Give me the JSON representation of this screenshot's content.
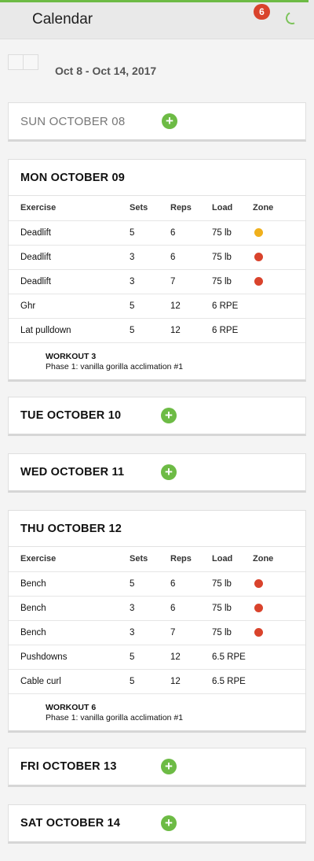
{
  "header": {
    "title": "Calendar",
    "notification_count": "6"
  },
  "week": {
    "range": "Oct 8 - Oct 14, 2017"
  },
  "columns": {
    "exercise": "Exercise",
    "sets": "Sets",
    "reps": "Reps",
    "load": "Load",
    "zone": "Zone"
  },
  "colors": {
    "accent": "#6dbb45",
    "badge": "#d9432c",
    "zone_red": "#d9432c",
    "zone_yellow": "#f0b01c"
  },
  "days": {
    "sun": {
      "label": "SUN OCTOBER 08"
    },
    "mon": {
      "label": "MON OCTOBER 09",
      "rows": [
        {
          "exercise": "Deadlift",
          "sets": "5",
          "reps": "6",
          "load": "75 lb",
          "zone": "yellow"
        },
        {
          "exercise": "Deadlift",
          "sets": "3",
          "reps": "6",
          "load": "75 lb",
          "zone": "red"
        },
        {
          "exercise": "Deadlift",
          "sets": "3",
          "reps": "7",
          "load": "75 lb",
          "zone": "red"
        },
        {
          "exercise": "Ghr",
          "sets": "5",
          "reps": "12",
          "load": "6 RPE",
          "zone": ""
        },
        {
          "exercise": "Lat pulldown",
          "sets": "5",
          "reps": "12",
          "load": "6 RPE",
          "zone": ""
        }
      ],
      "workout_title": "WORKOUT 3",
      "workout_phase": "Phase 1: vanilla gorilla acclimation #1"
    },
    "tue": {
      "label": "TUE OCTOBER 10"
    },
    "wed": {
      "label": "WED OCTOBER 11"
    },
    "thu": {
      "label": "THU OCTOBER 12",
      "rows": [
        {
          "exercise": "Bench",
          "sets": "5",
          "reps": "6",
          "load": "75 lb",
          "zone": "red"
        },
        {
          "exercise": "Bench",
          "sets": "3",
          "reps": "6",
          "load": "75 lb",
          "zone": "red"
        },
        {
          "exercise": "Bench",
          "sets": "3",
          "reps": "7",
          "load": "75 lb",
          "zone": "red"
        },
        {
          "exercise": "Pushdowns",
          "sets": "5",
          "reps": "12",
          "load": "6.5 RPE",
          "zone": ""
        },
        {
          "exercise": "Cable curl",
          "sets": "5",
          "reps": "12",
          "load": "6.5 RPE",
          "zone": ""
        }
      ],
      "workout_title": "WORKOUT 6",
      "workout_phase": "Phase 1: vanilla gorilla acclimation #1"
    },
    "fri": {
      "label": "FRI OCTOBER 13"
    },
    "sat": {
      "label": "SAT OCTOBER 14"
    }
  }
}
